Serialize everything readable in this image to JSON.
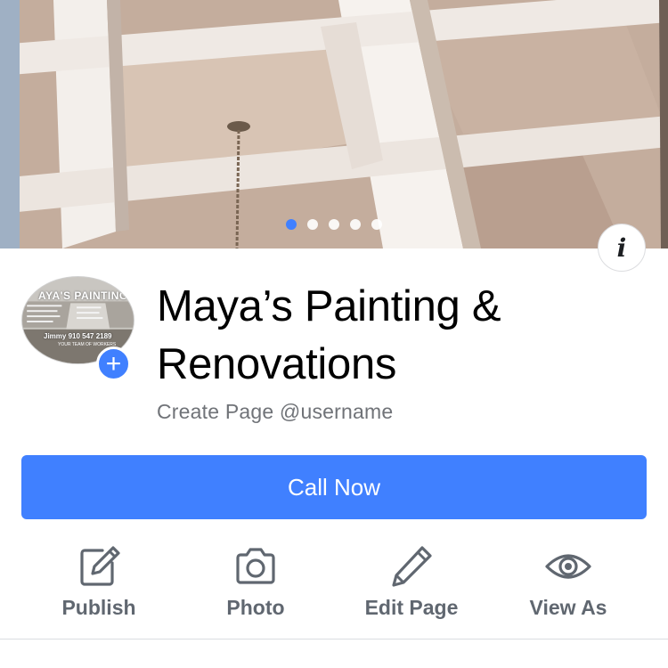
{
  "cover": {
    "slides_count": 5,
    "active_slide": 1
  },
  "profile": {
    "title": "Maya’s Painting & Renovations",
    "subtitle": "Create Page @username",
    "avatar_text_top": "AYA'S PAINTING",
    "avatar_text_phone": "Jimmy 910 547 2189",
    "avatar_text_sub": "YOUR TEAM OF WORKERS"
  },
  "cta": {
    "label": "Call Now"
  },
  "actions": [
    {
      "label": "Publish",
      "icon": "edit-square-icon"
    },
    {
      "label": "Photo",
      "icon": "camera-icon"
    },
    {
      "label": "Edit Page",
      "icon": "pencil-icon"
    },
    {
      "label": "View As",
      "icon": "eye-icon"
    }
  ],
  "colors": {
    "accent": "#4080ff",
    "action_gray": "#606770",
    "subtitle_gray": "#707378"
  }
}
